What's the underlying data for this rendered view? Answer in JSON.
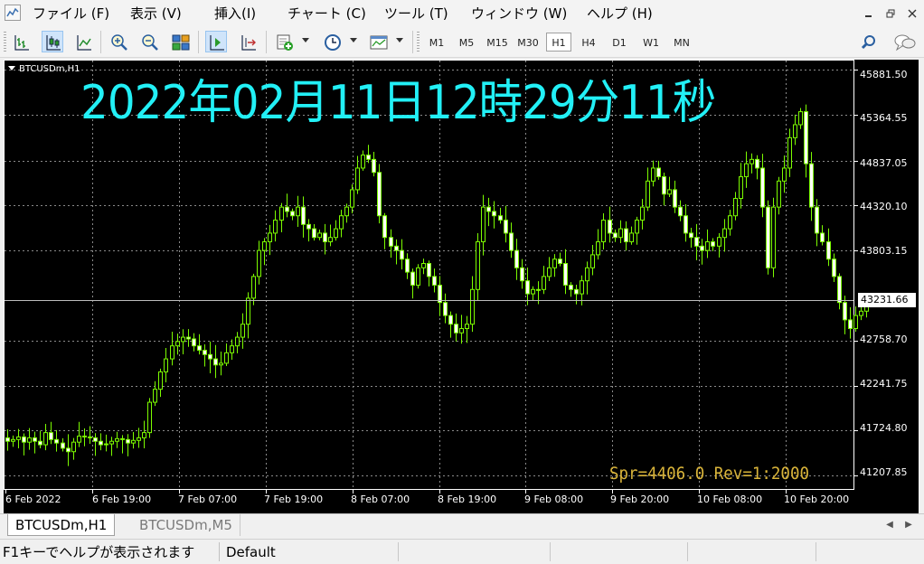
{
  "menu": {
    "items": [
      {
        "label": "ファイル (F)",
        "name": "menu-file"
      },
      {
        "label": "表示 (V)",
        "name": "menu-view"
      },
      {
        "label": "挿入(I)",
        "name": "menu-insert"
      },
      {
        "label": "チャート (C)",
        "name": "menu-chart"
      },
      {
        "label": "ツール (T)",
        "name": "menu-tools"
      },
      {
        "label": "ウィンドウ (W)",
        "name": "menu-window"
      },
      {
        "label": "ヘルプ (H)",
        "name": "menu-help"
      }
    ]
  },
  "toolbar": {
    "icons": [
      "bar-chart-icon",
      "candlestick-chart-icon",
      "line-chart-icon",
      "zoom-in-icon",
      "zoom-out-icon",
      "tile-windows-icon",
      "autoscroll-icon",
      "chart-shift-icon",
      "indicators-icon",
      "periods-clock-icon",
      "templates-icon",
      "search-icon",
      "chat-icon"
    ],
    "timeframes": [
      "M1",
      "M5",
      "M15",
      "M30",
      "H1",
      "H4",
      "D1",
      "W1",
      "MN"
    ],
    "active_timeframe": "H1"
  },
  "chart": {
    "label": "BTCUSDm,H1",
    "overlay_time": "2022年02月11日12時29分11秒",
    "overlay_spread": "Spr=4406.0 Rev=1:2000",
    "current_price": "43231.66",
    "background": "#000000",
    "candle_color": "#7cfc00",
    "bull_body_color": "#000000",
    "bear_body_color": "#ffffff",
    "time_overlay_color": "#22f0f6",
    "spread_overlay_color": "#d9b43a",
    "y_ticks": [
      "45881.50",
      "45364.55",
      "44837.05",
      "44320.10",
      "43803.15",
      "42758.70",
      "42241.75",
      "41724.80",
      "41207.85"
    ],
    "x_ticks": [
      "6 Feb 2022",
      "6 Feb 19:00",
      "7 Feb 07:00",
      "7 Feb 19:00",
      "8 Feb 07:00",
      "8 Feb 19:00",
      "9 Feb 08:00",
      "9 Feb 20:00",
      "10 Feb 08:00",
      "10 Feb 20:00"
    ]
  },
  "chart_data": {
    "type": "candlestick",
    "symbol": "BTCUSDm",
    "timeframe": "H1",
    "ylim": [
      41050,
      46000
    ],
    "y_ticks": [
      45881.5,
      45364.55,
      44837.05,
      44320.1,
      43803.15,
      42758.7,
      42241.75,
      41724.8,
      41207.85
    ],
    "close": [
      41600,
      41620,
      41650,
      41590,
      41640,
      41600,
      41560,
      41700,
      41620,
      41580,
      41520,
      41480,
      41590,
      41660,
      41650,
      41640,
      41600,
      41560,
      41570,
      41600,
      41630,
      41620,
      41580,
      41610,
      41640,
      41700,
      42050,
      42200,
      42400,
      42550,
      42700,
      42750,
      42800,
      42780,
      42700,
      42650,
      42600,
      42550,
      42480,
      42500,
      42620,
      42700,
      42800,
      42950,
      43250,
      43500,
      43800,
      43900,
      44000,
      44150,
      44300,
      44250,
      44200,
      44300,
      44100,
      44050,
      43950,
      44000,
      43900,
      43950,
      44050,
      44200,
      44300,
      44500,
      44750,
      44900,
      44850,
      44700,
      44200,
      43950,
      43850,
      43800,
      43700,
      43550,
      43400,
      43600,
      43650,
      43500,
      43400,
      43200,
      43050,
      42950,
      42850,
      42900,
      42950,
      43350,
      43900,
      44300,
      44250,
      44200,
      44150,
      44000,
      43800,
      43600,
      43450,
      43300,
      43350,
      43350,
      43500,
      43600,
      43700,
      43650,
      43400,
      43350,
      43300,
      43450,
      43600,
      43750,
      43900,
      44150,
      44000,
      43950,
      44050,
      43900,
      44000,
      44150,
      44300,
      44600,
      44750,
      44650,
      44450,
      44500,
      44300,
      44200,
      44000,
      43950,
      43850,
      43800,
      43900,
      43850,
      43950,
      44050,
      44200,
      44400,
      44650,
      44800,
      44850,
      44750,
      44300,
      43600,
      44300,
      44600,
      44750,
      45100,
      45250,
      45400,
      44800,
      44300,
      44000,
      43900,
      43700,
      43500,
      43200,
      43000,
      42900,
      43050,
      43100,
      43200
    ],
    "x_tick_labels": [
      "6 Feb 2022",
      "6 Feb 19:00",
      "7 Feb 07:00",
      "7 Feb 19:00",
      "8 Feb 07:00",
      "8 Feb 19:00",
      "9 Feb 08:00",
      "9 Feb 20:00",
      "10 Feb 08:00",
      "10 Feb 20:00"
    ],
    "current_price": 43231.66,
    "grid": true
  },
  "tabs": [
    {
      "label": "BTCUSDm,H1",
      "active": true
    },
    {
      "label": "BTCUSDm,M5",
      "active": false
    }
  ],
  "status": {
    "help_text": "F1キーでヘルプが表示されます",
    "profile": "Default"
  }
}
